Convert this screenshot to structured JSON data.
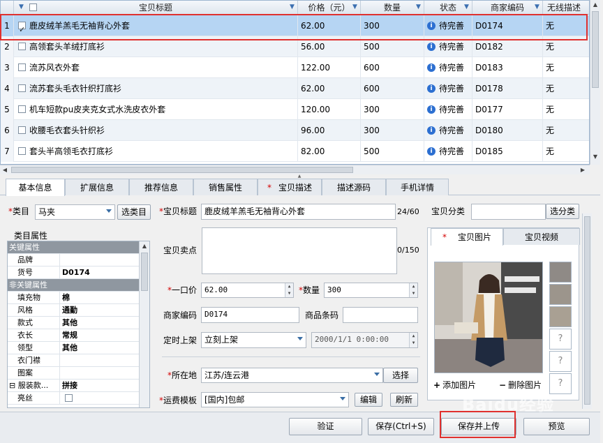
{
  "grid": {
    "headers": [
      "宝贝标题",
      "价格（元）",
      "数量",
      "状态",
      "商家编码",
      "无线描述"
    ],
    "rows": [
      {
        "n": "1",
        "title": "鹿皮绒羊羔毛无袖背心外套",
        "price": "62.00",
        "qty": "300",
        "status": "待完善",
        "code": "D0174",
        "wireless": "无",
        "checked": true
      },
      {
        "n": "2",
        "title": "高领套头羊绒打底衫",
        "price": "56.00",
        "qty": "500",
        "status": "待完善",
        "code": "D0182",
        "wireless": "无",
        "checked": false
      },
      {
        "n": "3",
        "title": "流苏风衣外套",
        "price": "122.00",
        "qty": "600",
        "status": "待完善",
        "code": "D0183",
        "wireless": "无",
        "checked": false
      },
      {
        "n": "4",
        "title": "流苏套头毛衣针织打底衫",
        "price": "62.00",
        "qty": "600",
        "status": "待完善",
        "code": "D0178",
        "wireless": "无",
        "checked": false
      },
      {
        "n": "5",
        "title": "机车短款pu皮夹克女式水洗皮衣外套",
        "price": "120.00",
        "qty": "300",
        "status": "待完善",
        "code": "D0177",
        "wireless": "无",
        "checked": false
      },
      {
        "n": "6",
        "title": "收腰毛衣套头针织衫",
        "price": "96.00",
        "qty": "300",
        "status": "待完善",
        "code": "D0180",
        "wireless": "无",
        "checked": false
      },
      {
        "n": "7",
        "title": "套头半高领毛衣打底衫",
        "price": "82.00",
        "qty": "500",
        "status": "待完善",
        "code": "D0185",
        "wireless": "无",
        "checked": false
      }
    ]
  },
  "tabs": [
    "基本信息",
    "扩展信息",
    "推荐信息",
    "销售属性",
    "宝贝描述",
    "描述源码",
    "手机详情"
  ],
  "form": {
    "category_label": "类目",
    "category_value": "马夹",
    "choose_category": "选类目",
    "title_label": "宝贝标题",
    "title_value": "鹿皮绒羊羔毛无袖背心外套",
    "title_count": "24/60",
    "shop_category_label": "宝贝分类",
    "choose_shop_category": "选分类",
    "selling_label": "宝贝卖点",
    "selling_count": "0/150",
    "price_label": "一口价",
    "price_value": "62.00",
    "qty_label": "数量",
    "qty_value": "300",
    "code_label": "商家编码",
    "code_value": "D0174",
    "barcode_label": "商品条码",
    "listing_label": "定时上架",
    "listing_value": "立刻上架",
    "listing_time": "2000/1/1 0:00:00",
    "location_label": "所在地",
    "location_value": "江苏/连云港",
    "choose_location": "选择",
    "shipping_label": "运费模板",
    "shipping_value": "[国内]包邮",
    "edit": "编辑",
    "refresh": "刷新"
  },
  "props": {
    "title": "类目属性",
    "rows": [
      {
        "k": "关键属性",
        "v": "",
        "group": true
      },
      {
        "k": "品牌",
        "v": ""
      },
      {
        "k": "货号",
        "v": "D0174"
      },
      {
        "k": "非关键属性",
        "v": "",
        "group": true
      },
      {
        "k": "填充物",
        "v": "棉"
      },
      {
        "k": "风格",
        "v": "通勤"
      },
      {
        "k": "款式",
        "v": "其他"
      },
      {
        "k": "衣长",
        "v": "常规"
      },
      {
        "k": "领型",
        "v": "其他"
      },
      {
        "k": "衣门襟",
        "v": ""
      },
      {
        "k": "图案",
        "v": ""
      },
      {
        "k": "服装款...",
        "v": "拼接"
      },
      {
        "k": "亮丝",
        "v": ""
      }
    ]
  },
  "images": {
    "tab_pictures": "宝贝图片",
    "tab_videos": "宝贝视频",
    "add": "添加图片",
    "remove": "删除图片",
    "placeholder": "?"
  },
  "bottom": {
    "verify": "验证",
    "save": "保存(Ctrl+S)",
    "save_upload": "保存并上传",
    "preview": "预览"
  },
  "watermark": "Baidu经验",
  "colors": {
    "selected_row": "#b6d5f3",
    "highlight": "#e0302e",
    "accent": "#2c6fd1"
  }
}
